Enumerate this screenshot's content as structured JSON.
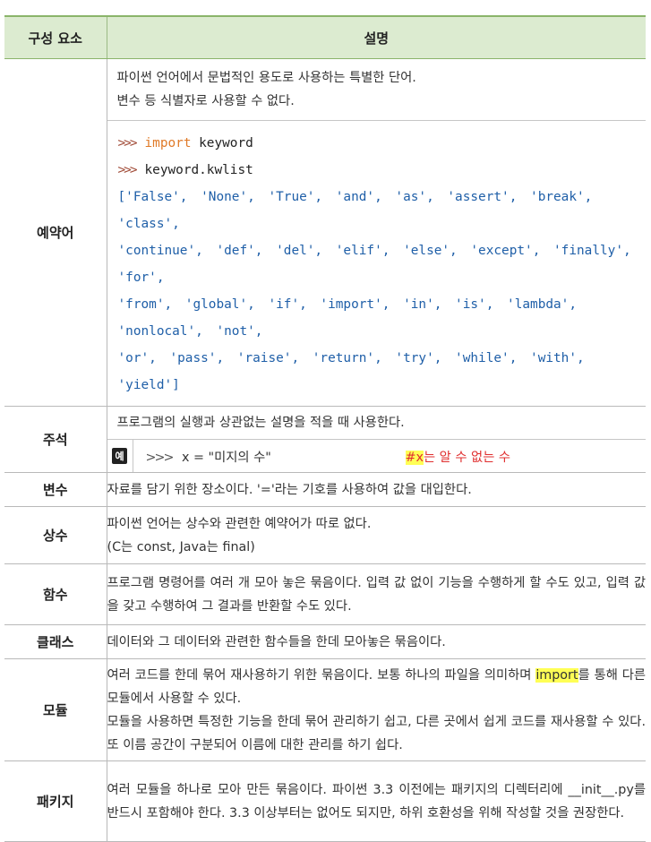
{
  "header": {
    "col1": "구성 요소",
    "col2": "설명"
  },
  "rows": {
    "reserved": {
      "term": "예약어",
      "desc": [
        "파이썬 언어에서 문법적인 용도로 사용하는 특별한 단어.",
        "변수 등 식별자로 사용할 수 없다."
      ],
      "code": {
        "prompt": ">>>",
        "line1_kw": "import",
        "line1_rest": " keyword",
        "line2": "keyword.kwlist",
        "output": [
          "['False', 'None', 'True', 'and', 'as', 'assert', 'break', 'class',",
          "'continue', 'def', 'del', 'elif', 'else', 'except', 'finally', 'for',",
          "'from', 'global', 'if', 'import', 'in', 'is', 'lambda', 'nonlocal', 'not',",
          "'or', 'pass', 'raise', 'return', 'try', 'while', 'with', 'yield']"
        ]
      }
    },
    "comment": {
      "term": "주석",
      "desc": "프로그램의 실행과 상관없는 설명을 적을 때 사용한다.",
      "example": {
        "badge": "예",
        "prompt": ">>>",
        "code": "x = \"미지의 수\"",
        "comment_hl": "#x",
        "comment_rest": "는 알 수 없는 수"
      }
    },
    "variable": {
      "term": "변수",
      "desc": "자료를 담기 위한 장소이다. '='라는 기호를 사용하여 값을 대입한다."
    },
    "constant": {
      "term": "상수",
      "desc": [
        "파이썬 언어는 상수와 관련한 예약어가 따로 없다.",
        "(C는 const, Java는 final)"
      ]
    },
    "function": {
      "term": "함수",
      "desc": "프로그램 명령어를 여러 개 모아 놓은 묶음이다. 입력 값 없이 기능을 수행하게 할 수도 있고, 입력 값을 갖고 수행하여 그 결과를 반환할 수도 있다."
    },
    "class": {
      "term": "클래스",
      "desc": "데이터와 그 데이터와 관련한 함수들을 한데 모아놓은 묶음이다."
    },
    "module": {
      "term": "모듈",
      "desc1_a": "여러 코드를 한데 묶어 재사용하기 위한 묶음이다. 보통 하나의 파일을 의미하며 ",
      "desc1_hl": "import",
      "desc1_b": "를 통해 다른 모듈에서 사용할 수 있다.",
      "desc2": "모듈을 사용하면 특정한 기능을 한데 묶어 관리하기 쉽고, 다른 곳에서 쉽게 코드를 재사용할 수 있다. 또 이름 공간이 구분되어 이름에 대한 관리를 하기 쉽다."
    },
    "package": {
      "term": "패키지",
      "desc": "여러 모듈을 하나로 모아 만든 묶음이다. 파이썬 3.3 이전에는 패키지의 디렉터리에 __init__.py를 반드시 포함해야 한다. 3.3 이상부터는 없어도 되지만, 하위 호환성을 위해 작성할 것을 권장한다."
    }
  }
}
